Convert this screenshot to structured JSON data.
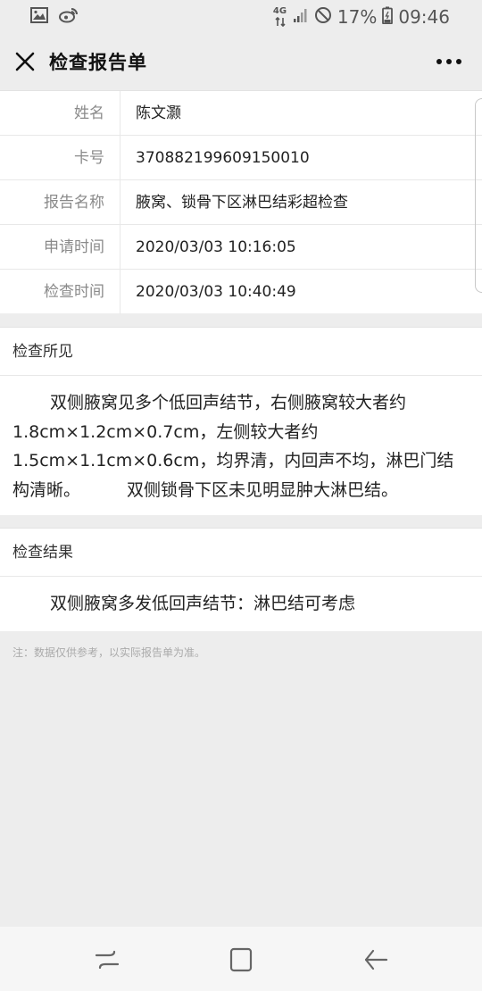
{
  "status_bar": {
    "network": "4G",
    "battery": "17%",
    "time": "09:46",
    "icons": [
      "gallery-icon",
      "weibo-icon",
      "network-4g-icon",
      "signal-icon",
      "do-not-disturb-icon",
      "battery-icon"
    ]
  },
  "header": {
    "title": "检查报告单",
    "close_icon": "close-icon",
    "more_icon": "more-icon"
  },
  "patient_info": {
    "rows": [
      {
        "label": "姓名",
        "value": "陈文灏"
      },
      {
        "label": "卡号",
        "value": "370882199609150010"
      },
      {
        "label": "报告名称",
        "value": "腋窝、锁骨下区淋巴结彩超检查"
      },
      {
        "label": "申请时间",
        "value": "2020/03/03 10:16:05"
      },
      {
        "label": "检查时间",
        "value": "2020/03/03 10:40:49"
      }
    ]
  },
  "findings": {
    "title": "检查所见",
    "line1": "双侧腋窝见多个低回声结节，右侧腋窝较大者约",
    "line2": "1.8cm×1.2cm×0.7cm，左侧较大者约",
    "line3": "1.5cm×1.1cm×0.6cm，均界清，内回声不均，淋巴门结",
    "line4a": "构清晰。",
    "line4b": "双侧锁骨下区未见明显肿大淋巴结。"
  },
  "result": {
    "title": "检查结果",
    "text": "双侧腋窝多发低回声结节：淋巴结可考虑"
  },
  "note": "注：数据仅供参考，以实际报告单为准。",
  "nav_bar": {
    "icons": [
      "recent-apps-icon",
      "home-icon",
      "back-icon"
    ]
  }
}
